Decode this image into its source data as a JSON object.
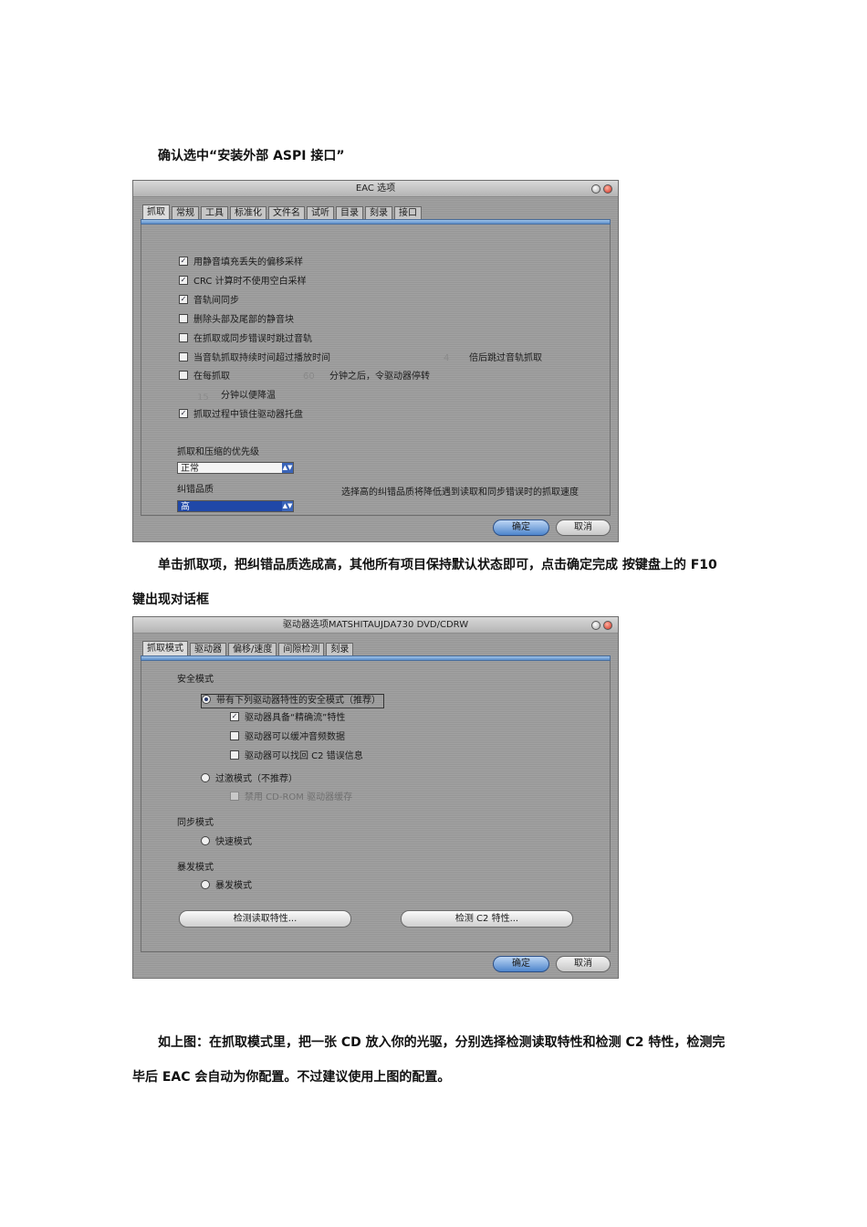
{
  "text": {
    "para1": "确认选中“安装外部 ASPI 接口”",
    "para2_line1": "单击抓取项，把纠错品质选成高，其他所有项目保持默认状态即可，点击确定完成 按键盘上的 F10",
    "para2_line2": "键出现对话框",
    "para3_line1": "如上图：在抓取模式里，把一张 CD 放入你的光驱，分别选择检测读取特性和检测 C2 特性，检测完",
    "para3_line2": "毕后 EAC 会自动为你配置。不过建议使用上图的配置。"
  },
  "dialog1": {
    "title": "EAC 选项",
    "tabs": [
      "抓取",
      "常规",
      "工具",
      "标准化",
      "文件名",
      "试听",
      "目录",
      "刻录",
      "接口"
    ],
    "options": [
      {
        "label": "用静音填充丢失的偏移采样",
        "checked": true
      },
      {
        "label": "CRC 计算时不使用空白采样",
        "checked": true
      },
      {
        "label": "音轨间同步",
        "checked": true
      },
      {
        "label": "删除头部及尾部的静音块",
        "checked": false
      },
      {
        "label": "在抓取或同步错误时跳过音轨",
        "checked": false
      },
      {
        "label": "当音轨抓取持续时间超过播放时间",
        "checked": false
      },
      {
        "label": "在每抓取",
        "checked": false
      }
    ],
    "skip_value": "4",
    "skip_suffix": "倍后跳过音轨抓取",
    "spin_value": "60",
    "spin_suffix": "分钟之后，令驱动器停转",
    "cool_value": "15",
    "cool_suffix": "分钟以便降温",
    "lock_tray": {
      "label": "抓取过程中锁住驱动器托盘",
      "checked": true
    },
    "priority_label": "抓取和压缩的优先级",
    "priority_value": "正常",
    "quality_label": "纠错品质",
    "quality_value": "高",
    "quality_note": "选择高的纠错品质将降低遇到读取和同步错误时的抓取速度",
    "ok": "确定",
    "cancel": "取消"
  },
  "dialog2": {
    "title": "驱动器选项MATSHITAUJDA730 DVD/CDRW",
    "tabs": [
      "抓取模式",
      "驱动器",
      "偏移/速度",
      "间隙检测",
      "刻录"
    ],
    "secure_heading": "安全模式",
    "secure_option": "带有下列驱动器特性的安全模式（推荐）",
    "features": [
      {
        "label": "驱动器具备“精确流”特性",
        "checked": true
      },
      {
        "label": "驱动器可以缓冲音频数据",
        "checked": false
      },
      {
        "label": "驱动器可以找回 C2 错误信息",
        "checked": false
      }
    ],
    "paranoid_option": "过激模式（不推荐）",
    "disable_cache": "禁用 CD-ROM 驱动器缓存",
    "sync_heading": "同步模式",
    "fast_option": "快速模式",
    "burst_heading": "暴发模式",
    "burst_option": "暴发模式",
    "detect_read": "检测读取特性...",
    "detect_c2": "检测 C2 特性...",
    "ok": "确定",
    "cancel": "取消"
  }
}
